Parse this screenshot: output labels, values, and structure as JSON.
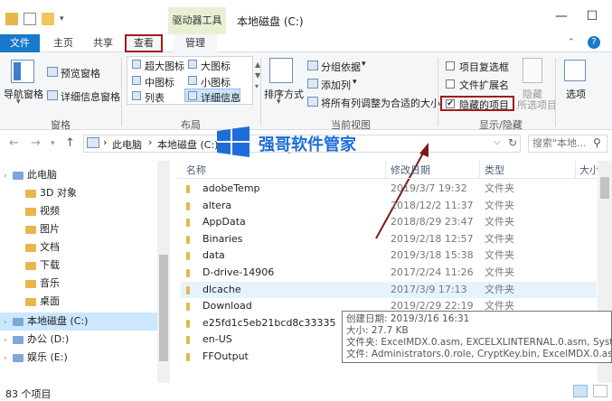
{
  "window": {
    "title": "本地磁盘 (C:)",
    "context_tab": "驱动器工具",
    "minimize": "—",
    "maximize": "☐"
  },
  "tabs": [
    "文件",
    "主页",
    "共享",
    "查看",
    "管理"
  ],
  "ribbon": {
    "panes": {
      "nav_pane": "导航窗格",
      "preview_pane": "预览窗格",
      "details_pane": "详细信息窗格",
      "label": "窗格"
    },
    "layout": {
      "items": [
        "超大图标",
        "大图标",
        "中图标",
        "小图标",
        "列表",
        "详细信息"
      ],
      "label": "布局"
    },
    "current_view": {
      "sort": "排序方式",
      "group_by": "分组依据",
      "add_column": "添加列",
      "fit_columns": "将所有列调整为合适的大小",
      "label": "当前视图"
    },
    "show_hide": {
      "item_checkboxes": "项目复选框",
      "file_extensions": "文件扩展名",
      "hidden_items": "隐藏的项目",
      "hide_selected": "隐藏",
      "hide_selected_sub": "所选项目",
      "options": "选项",
      "label": "显示/隐藏"
    }
  },
  "address": {
    "path": [
      "此电脑",
      "本地磁盘 (C:)"
    ],
    "search_placeholder": "搜索\"本地...",
    "refresh": "↻",
    "dropdown": "⌵"
  },
  "nav": {
    "items": [
      {
        "label": "此电脑",
        "selected": false
      },
      {
        "label": "3D 对象",
        "selected": false
      },
      {
        "label": "视频",
        "selected": false
      },
      {
        "label": "图片",
        "selected": false
      },
      {
        "label": "文档",
        "selected": false
      },
      {
        "label": "下载",
        "selected": false
      },
      {
        "label": "音乐",
        "selected": false
      },
      {
        "label": "桌面",
        "selected": false
      },
      {
        "label": "本地磁盘 (C:)",
        "selected": true
      },
      {
        "label": "办公 (D:)",
        "selected": false
      },
      {
        "label": "娱乐 (E:)",
        "selected": false
      }
    ]
  },
  "columns": {
    "name": "名称",
    "date": "修改日期",
    "type": "类型",
    "size": "大小"
  },
  "files": [
    {
      "name": "adobeTemp",
      "date": "2019/3/7 19:32",
      "type": "文件夹",
      "selected": false
    },
    {
      "name": "altera",
      "date": "2018/12/2 11:37",
      "type": "文件夹",
      "selected": false
    },
    {
      "name": "AppData",
      "date": "2018/8/29 23:47",
      "type": "文件夹",
      "selected": false
    },
    {
      "name": "Binaries",
      "date": "2019/2/18 12:57",
      "type": "文件夹",
      "selected": false
    },
    {
      "name": "data",
      "date": "2019/3/18 15:38",
      "type": "文件夹",
      "selected": false
    },
    {
      "name": "D-drive-14906",
      "date": "2017/2/24 11:26",
      "type": "文件夹",
      "selected": false
    },
    {
      "name": "dlcache",
      "date": "2017/3/9 17:13",
      "type": "文件夹",
      "selected": true
    },
    {
      "name": "Download",
      "date": "2019/2/29 22:19",
      "type": "文件夹",
      "selected": false
    },
    {
      "name": "e25fd1c5eb21bcd8c33335",
      "date": "",
      "type": "",
      "selected": false
    },
    {
      "name": "en-US",
      "date": "",
      "type": "",
      "selected": false
    },
    {
      "name": "FFOutput",
      "date": "",
      "type": "",
      "selected": false
    }
  ],
  "tooltip": {
    "created": "创建日期: 2019/3/16 16:31",
    "size": "大小: 27.7 KB",
    "files": "文件夹: ExcelMDX.0.asm, EXCELXLINTERNAL.0.asm, System",
    "files2": "文件: Administrators.0.role, CryptKey.bin, ExcelMDX.0.asm"
  },
  "status": {
    "count": "83 个项目"
  },
  "watermark": {
    "text": "强哥软件管家"
  },
  "colors": {
    "accent": "#1979ca",
    "highlight_border": "#a31b1b",
    "context_tab": "#e8f0d3"
  }
}
